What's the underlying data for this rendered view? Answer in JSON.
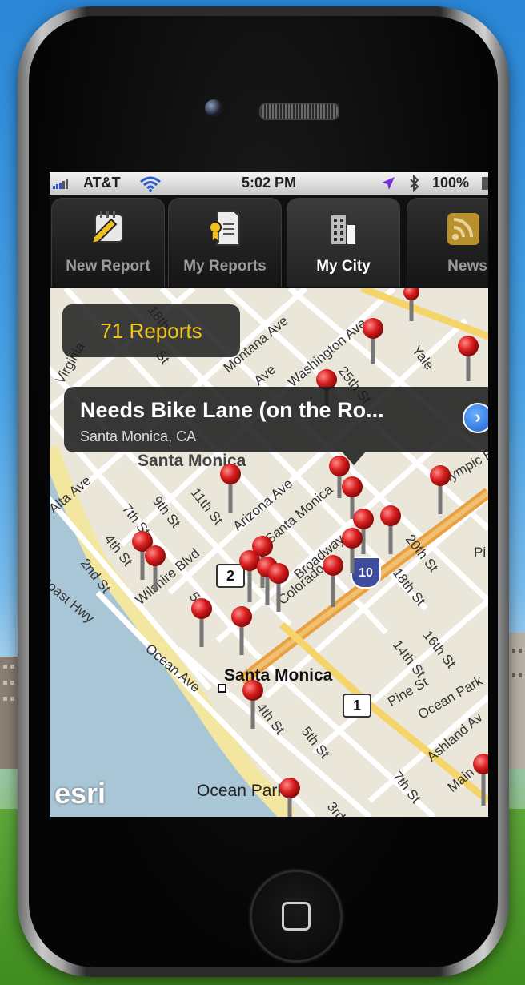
{
  "status_bar": {
    "carrier": "AT&T",
    "time": "5:02 PM",
    "battery": "100%",
    "signal_icon": "signal-bars-icon",
    "wifi_icon": "wifi-icon",
    "location_icon": "location-arrow-icon",
    "bluetooth_icon": "bluetooth-icon",
    "battery_icon": "battery-icon"
  },
  "tabs": [
    {
      "label": "New Report",
      "icon": "pencil-note-icon",
      "active": false
    },
    {
      "label": "My Reports",
      "icon": "document-badge-icon",
      "active": false
    },
    {
      "label": "My City",
      "icon": "building-icon",
      "active": true
    },
    {
      "label": "News",
      "icon": "rss-icon",
      "active": false
    }
  ],
  "map": {
    "report_count": "71 Reports",
    "callout": {
      "title": "Needs Bike Lane (on the Ro...",
      "subtitle": "Santa Monica, CA"
    },
    "watermark": "esri",
    "pin_icon": "map-pin-icon",
    "pin_color": "#d81e1e",
    "labels": {
      "santa_monica_city": "Santa Monica",
      "santa_monica_area": "Santa Monica",
      "ocean_park": "Ocean Park",
      "montana_ave": "Montana Ave",
      "washington_ave": "Washington Ave",
      "ave_fragment": "Ave",
      "street_25th": "25th St",
      "yale": "Yale",
      "street_18th_top": "18th",
      "st_top": "St",
      "virginia": "Virginia",
      "olympic": "Olympic Bl",
      "alta_ave": "Alta Ave",
      "street_7th": "7th St",
      "street_9th": "9th St",
      "street_11th": "11th St",
      "arizona_ave": "Arizona Ave",
      "santa_monica_blvd": "Santa Monica",
      "broadway": "Broadway",
      "colorado": "Colorado",
      "street_20th": "20th St",
      "street_4th": "4th St",
      "street_2nd": "2nd St",
      "wilshire_blvd": "Wilshire Blvd",
      "coast_hwy": "Coast Hwy",
      "street_18th": "18th St",
      "street_16th": "16th St",
      "street_14th": "14th St",
      "ocean_ave": "Ocean Ave",
      "street_5th": "5th St",
      "pine_st": "Pine St",
      "ocean_park_blvd": "Ocean Park",
      "ashland": "Ashland Av",
      "street_7th_bottom": "7th St",
      "street_3rd": "3rd",
      "street_4th_bottom": "4th St",
      "main": "Main",
      "street_5th_mid": "5th",
      "pi": "Pi"
    },
    "route_shields": {
      "route_2": "2",
      "route_1": "1",
      "interstate_10": "10"
    }
  }
}
